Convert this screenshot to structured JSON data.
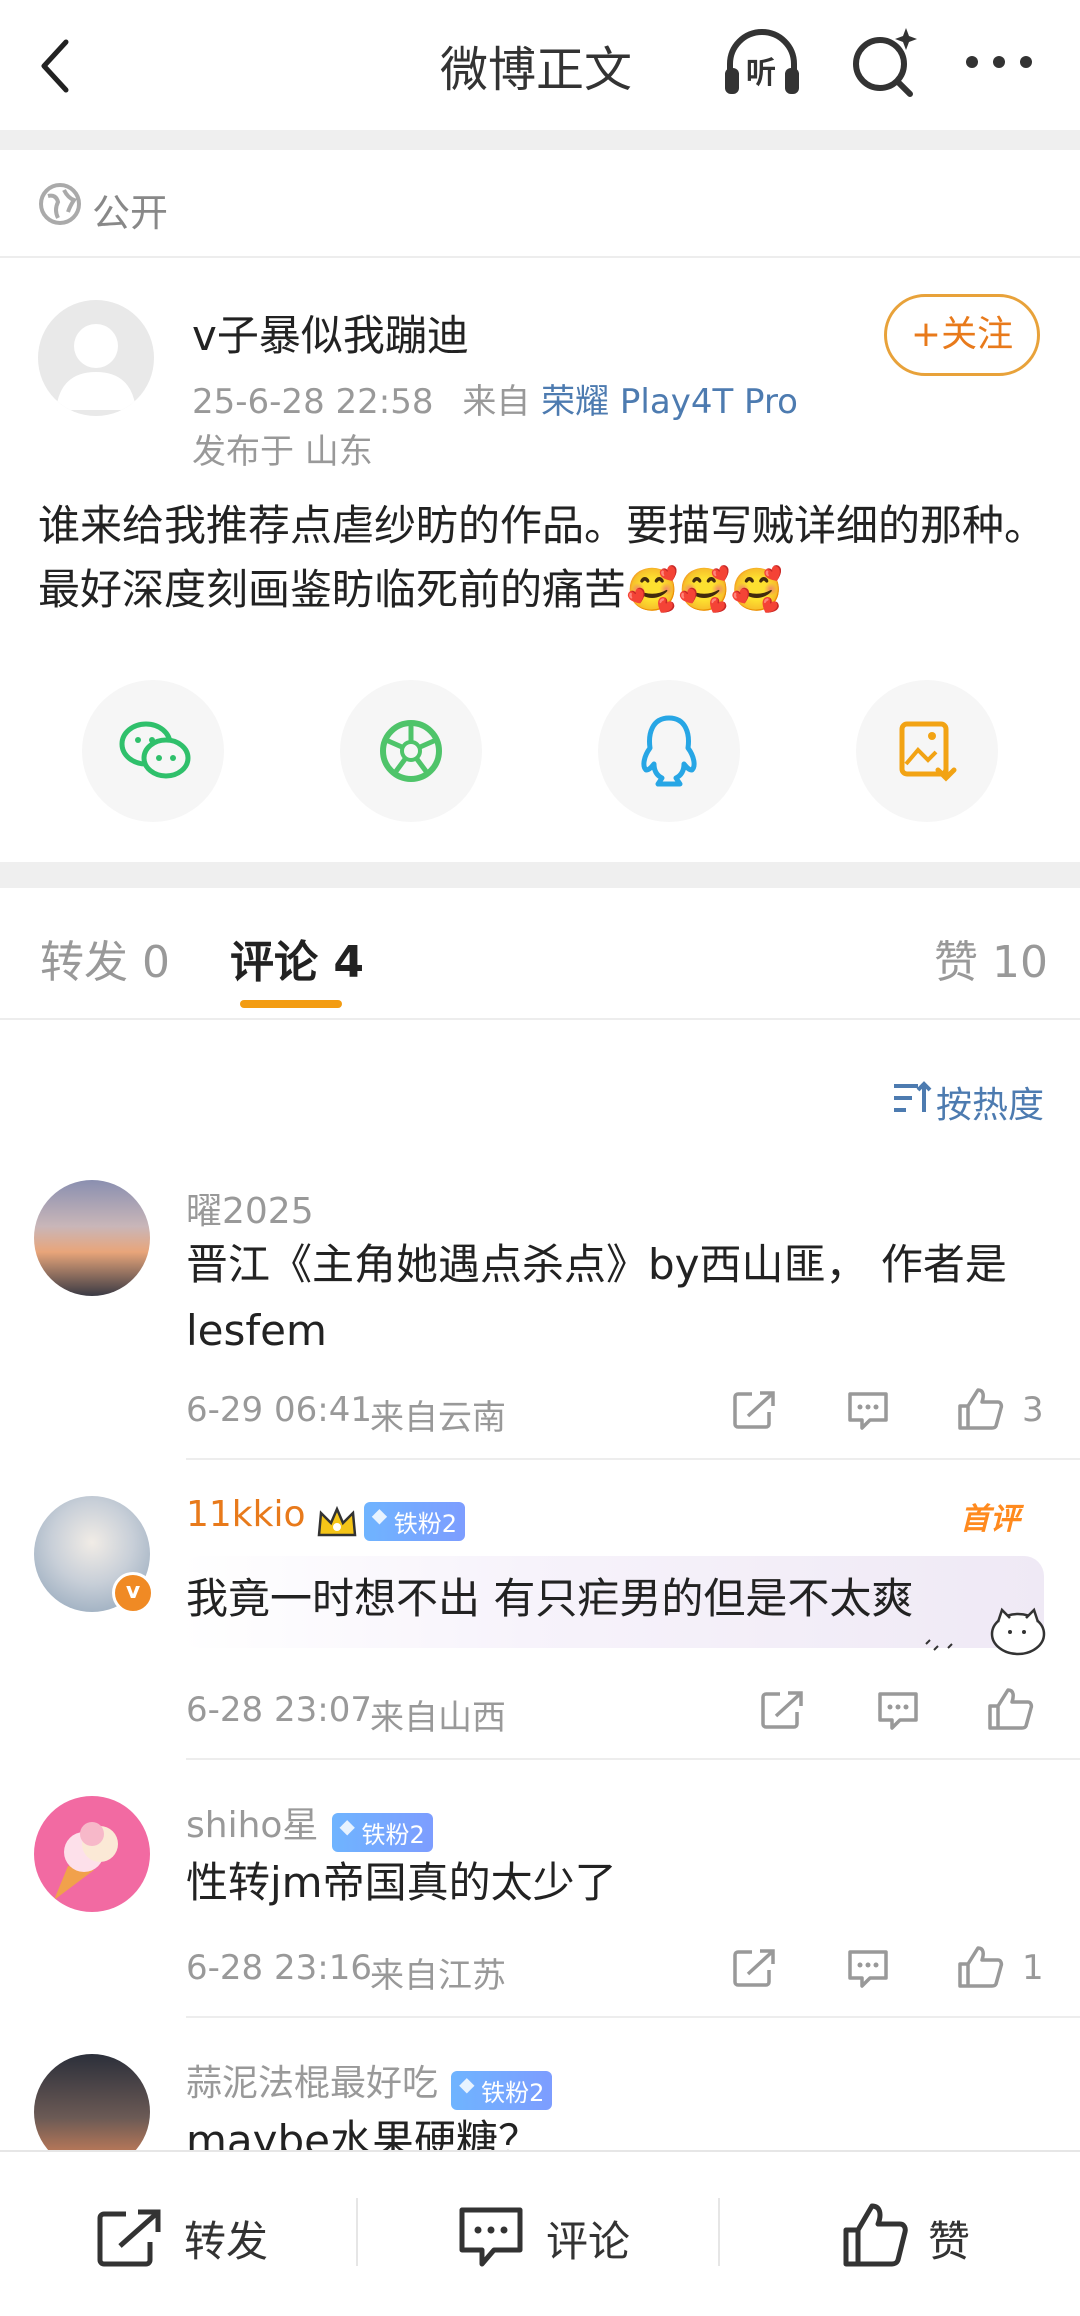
{
  "header": {
    "title": "微博正文",
    "listen_label": "听"
  },
  "visibility": {
    "label": "公开"
  },
  "post": {
    "author": "v子暴似我蹦迪",
    "follow_label": "+关注",
    "time": "25-6-28 22:58",
    "from_prefix": "来自",
    "device": "荣耀 Play4T Pro",
    "location": "发布于 山东",
    "text": "谁来给我推荐点虐纱眆的作品。要描写贼详细的那种。最好深度刻画鉴眆临死前的痛苦🥰🥰🥰"
  },
  "share_icons": [
    "wechat-icon",
    "moments-icon",
    "qq-icon",
    "save-image-icon"
  ],
  "tabs": {
    "repost": "转发 0",
    "comment": "评论 4",
    "like": "赞 10"
  },
  "sort": {
    "label": "按热度"
  },
  "comments": [
    {
      "name": "曜2025",
      "text": "晋江《主角她遇点杀点》by西山匪， 作者是lesfem",
      "time": "6-29 06:41",
      "region": "来自云南",
      "likes": "3"
    },
    {
      "name": "11kkio",
      "badge": "铁粉2",
      "tag": "首评",
      "text": "我竟一时想不出 有只疟男的但是不太爽",
      "time": "6-28 23:07",
      "region": "来自山西",
      "likes": ""
    },
    {
      "name": "shiho星",
      "badge": "铁粉2",
      "text": "性转jm帝国真的太少了",
      "time": "6-28 23:16",
      "region": "来自江苏",
      "likes": "1"
    },
    {
      "name": "蒜泥法棍最好吃",
      "badge": "铁粉2",
      "text": "maybe水果硬糖？"
    }
  ],
  "bottom_bar": {
    "repost": "转发",
    "comment": "评论",
    "like": "赞"
  },
  "colors": {
    "accent": "#e87a1b",
    "link": "#4d7bb0",
    "tab_indicator": "#f39c12"
  }
}
